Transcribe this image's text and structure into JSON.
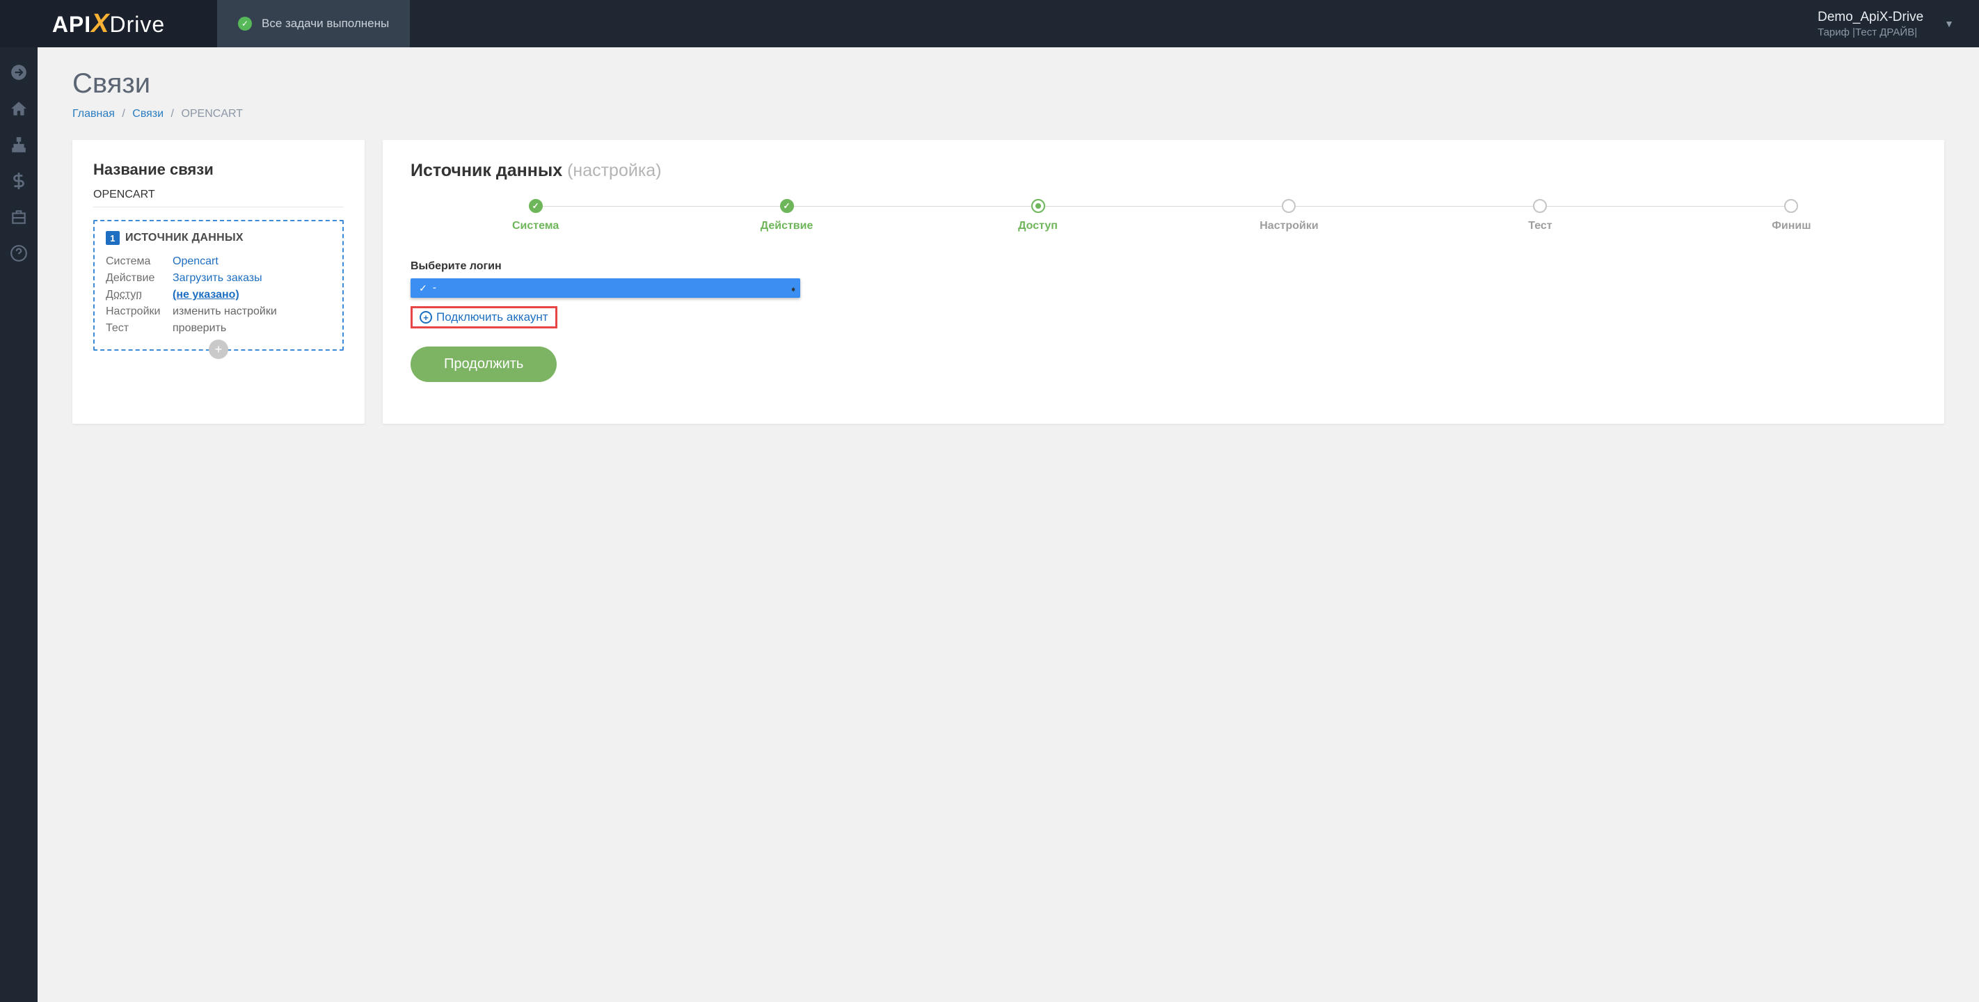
{
  "header": {
    "logo_pre": "API",
    "logo_x": "X",
    "logo_post": "Drive",
    "status_text": "Все задачи выполнены",
    "account_name": "Demo_ApiX-Drive",
    "account_tariff": "Тариф |Тест ДРАЙВ|"
  },
  "page": {
    "title": "Связи",
    "breadcrumb": {
      "home": "Главная",
      "links": "Связи",
      "current": "OPENCART"
    }
  },
  "left_panel": {
    "title": "Название связи",
    "connection_name": "OPENCART",
    "source_title": "ИСТОЧНИК ДАННЫХ",
    "rows": {
      "system_k": "Система",
      "system_v": "Opencart",
      "action_k": "Действие",
      "action_v": "Загрузить заказы",
      "access_k": "Доступ",
      "access_v": "(не указано)",
      "settings_k": "Настройки",
      "settings_v": "изменить настройки",
      "test_k": "Тест",
      "test_v": "проверить"
    }
  },
  "right_panel": {
    "title": "Источник данных",
    "subtitle": "(настройка)",
    "steps": {
      "s1": "Система",
      "s2": "Действие",
      "s3": "Доступ",
      "s4": "Настройки",
      "s5": "Тест",
      "s6": "Финиш"
    },
    "form_label": "Выберите логин",
    "select_value": "-",
    "connect_text": "Подключить аккаунт",
    "continue_btn": "Продолжить"
  }
}
